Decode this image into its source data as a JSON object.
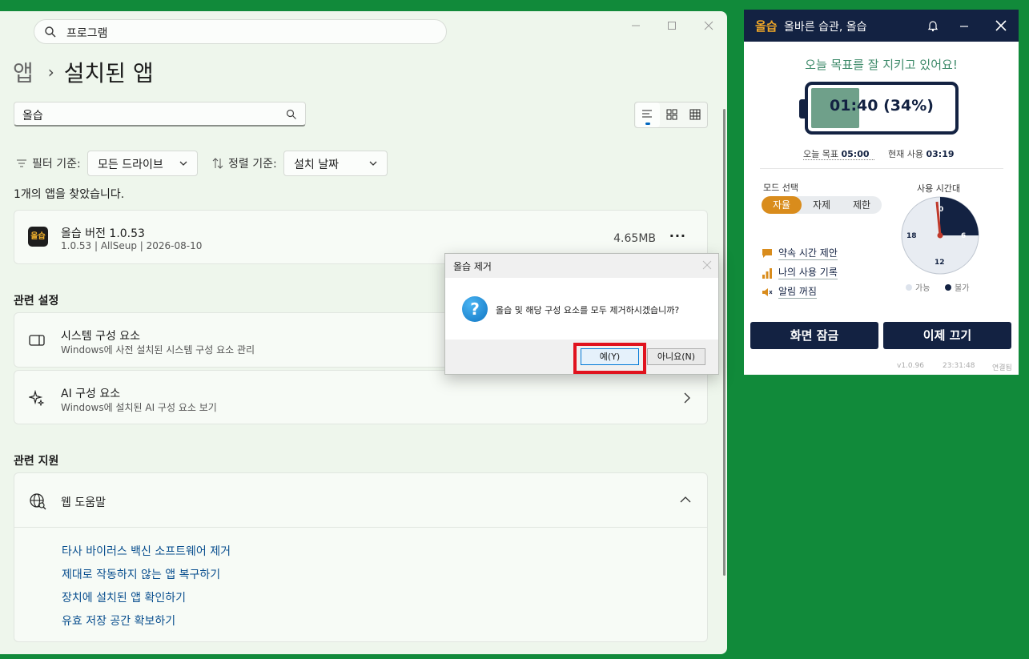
{
  "settings": {
    "top_search": "프로그램",
    "breadcrumb": {
      "parent": "앱",
      "separator": "›",
      "current": "설치된 앱"
    },
    "app_search_value": "올습",
    "filter_label": "필터 기준:",
    "filter_value": "모든 드라이브",
    "sort_label": "정렬 기준:",
    "sort_value": "설치 날짜",
    "found_text": "1개의 앱을 찾았습니다.",
    "app": {
      "logo": "올습",
      "name": "올습 버전 1.0.53",
      "meta": "1.0.53  |  AllSeup  |  2026-08-10",
      "size": "4.65MB",
      "more": "···"
    },
    "related_settings_title": "관련 설정",
    "related": [
      {
        "title": "시스템 구성 요소",
        "sub": "Windows에 사전 설치된 시스템 구성 요소 관리"
      },
      {
        "title": "AI 구성 요소",
        "sub": "Windows에 설치된 AI 구성 요소 보기"
      }
    ],
    "related_support_title": "관련 지원",
    "web_help": "웹 도움말",
    "links": [
      "타사 바이러스 백신 소프트웨어 제거",
      "제대로 작동하지 않는 앱 복구하기",
      "장치에 설치된 앱 확인하기",
      "유효 저장 공간 확보하기"
    ]
  },
  "dialog": {
    "title": "올습 제거",
    "icon": "?",
    "message": "올습 및 해당 구성 요소를 모두 제거하시겠습니까?",
    "yes": "예(Y)",
    "no": "아니요(N)"
  },
  "widget": {
    "logo": "올습",
    "title": "올바른 습관, 올습",
    "goal_message": "오늘 목표를 잘 지키고 있어요!",
    "battery_text": "01:40 (34%)",
    "battery_level": 0.34,
    "today_goal_label": "오늘 목표",
    "today_goal_value": "05:00",
    "current_use_label": "현재 사용",
    "current_use_value": "03:19",
    "mode_label": "모드 선택",
    "modes": [
      "자율",
      "자제",
      "제한"
    ],
    "active_mode": "자율",
    "features": [
      "약속 시간 제안",
      "나의 사용 기록",
      "알림 꺼짐"
    ],
    "clock_label": "사용 시간대",
    "clock_ticks": {
      "top": "0",
      "right": "6",
      "bottom": "12",
      "left": "18"
    },
    "legend_available": "가능",
    "legend_blocked": "불가",
    "lock_button": "화면 잠금",
    "quit_button": "이제 끄기",
    "version": "v1.0.96",
    "time": "23:31:48",
    "status": "연결됨",
    "colors": {
      "navy": "#132242",
      "orange": "#d98c1c",
      "battery_fill": "#6fa08a"
    }
  }
}
